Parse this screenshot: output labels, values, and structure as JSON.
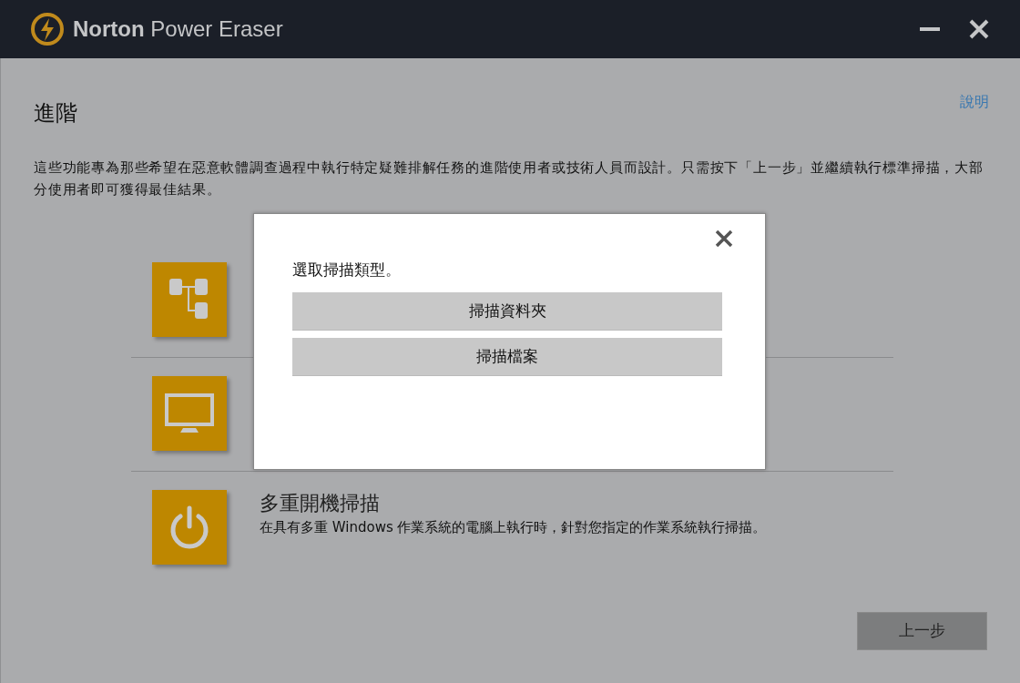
{
  "window": {
    "title_bold": "Norton",
    "title_rest": "Power Eraser",
    "controls": [
      {
        "kind": "minimize"
      },
      {
        "kind": "close"
      }
    ]
  },
  "page": {
    "heading": "進階",
    "help_link": "說明",
    "intro": "這些功能專為那些希望在惡意軟體調查過程中執行特定疑難排解任務的進階使用者或技術人員而設計。只需按下「上一步」並繼續執行標準掃描，大部分使用者即可獲得最佳結果。"
  },
  "options": [
    {
      "kind": "tree"
    },
    {
      "kind": "monitor"
    },
    {
      "kind": "power",
      "title": "多重開機掃描",
      "description": "在具有多重 Windows 作業系統的電腦上執行時，針對您指定的作業系統執行掃描。"
    }
  ],
  "back_button": "上一步",
  "dialog": {
    "prompt": "選取掃描類型。",
    "buttons": [
      "掃描資料夾",
      "掃描檔案"
    ]
  }
}
